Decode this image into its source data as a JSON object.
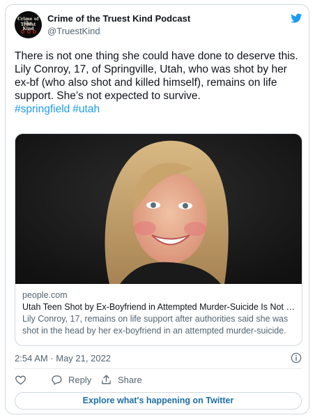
{
  "author": {
    "name": "Crime of the Truest Kind Podcast",
    "handle": "@TruestKind",
    "avatar_text": [
      "Crime of the",
      "Truest Kind"
    ]
  },
  "tweet": {
    "paragraphs": [
      "There is not one thing she could have done to deserve this.",
      "Lily Conroy, 17, of Springville, Utah, who was shot by her ex-bf (who also shot and killed himself), remains on life support. She’s not expected to survive."
    ],
    "hashtags": [
      "#springfield",
      "#utah"
    ]
  },
  "card": {
    "domain": "people.com",
    "title": "Utah Teen Shot by Ex-Boyfriend in Attempted Murder-Suicide Is Not Exp...",
    "description": "Lily Conroy, 17, remains on life support after authorities said she was shot in the head by her ex-boyfriend in an attempted murder-suicide."
  },
  "timestamp": "2:54 AM · May 21, 2022",
  "actions": {
    "reply": "Reply",
    "share": "Share"
  },
  "explore": "Explore what's happening on Twitter",
  "icons": {
    "brand": "twitter-bird-icon",
    "info": "info-icon",
    "like": "heart-icon",
    "reply": "speech-bubble-icon",
    "share": "upload-arrow-icon"
  },
  "colors": {
    "accent": "#1d9bf0",
    "text": "#0f1419",
    "muted": "#536471",
    "border": "#cfd9de"
  }
}
